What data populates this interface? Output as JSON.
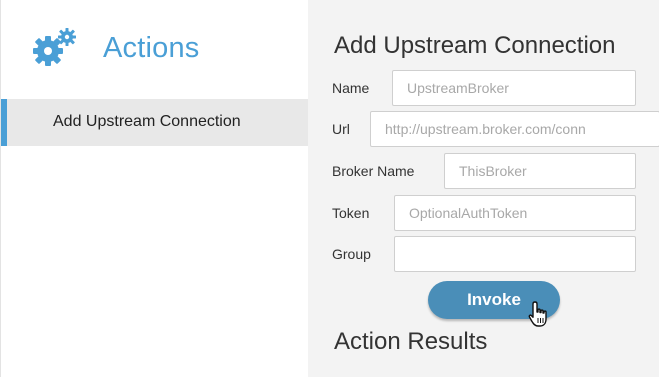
{
  "sidebar": {
    "title": "Actions",
    "icon": "gears-icon",
    "items": [
      {
        "label": "Add Upstream Connection",
        "selected": true
      }
    ]
  },
  "main": {
    "title": "Add Upstream Connection",
    "fields": {
      "name": {
        "label": "Name",
        "value": "",
        "placeholder": "UpstreamBroker"
      },
      "url": {
        "label": "Url",
        "value": "",
        "placeholder": "http://upstream.broker.com/conn"
      },
      "broker_name": {
        "label": "Broker Name",
        "value": "",
        "placeholder": "ThisBroker"
      },
      "token": {
        "label": "Token",
        "value": "",
        "placeholder": "OptionalAuthToken"
      },
      "group": {
        "label": "Group",
        "value": "",
        "placeholder": ""
      }
    },
    "invoke_label": "Invoke",
    "results_title": "Action Results"
  },
  "colors": {
    "accent": "#4a9fd6",
    "button": "#4a8eb8",
    "sidebar_selected_bg": "#e8e8e8",
    "main_bg": "#f3f3f3"
  }
}
